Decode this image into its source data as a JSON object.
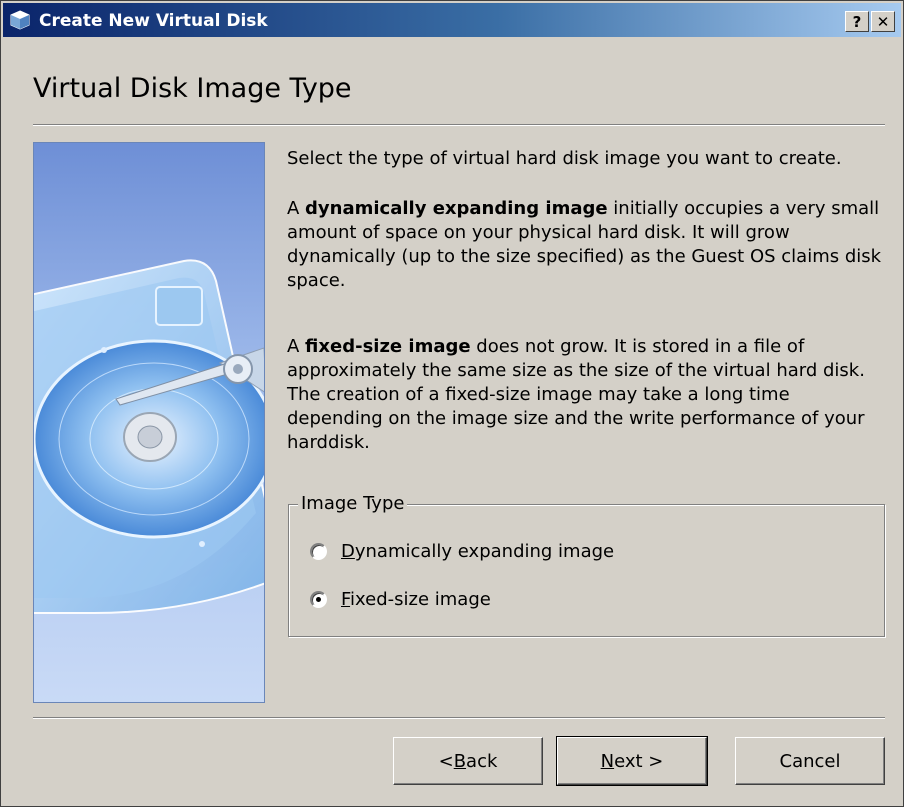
{
  "window": {
    "title": "Create New Virtual Disk",
    "help_glyph": "?",
    "close_glyph": "✕"
  },
  "page": {
    "heading": "Virtual Disk Image Type",
    "intro": "Select the type of virtual hard disk image you want to create.",
    "dynamic_prefix": "A ",
    "dynamic_term": "dynamically expanding image",
    "dynamic_rest": " initially occupies a very small amount of space on your physical hard disk. It will grow dynamically (up to the size specified) as the Guest OS claims disk space.",
    "fixed_prefix": "A ",
    "fixed_term": "fixed-size image",
    "fixed_rest": " does not grow. It is stored in a file of approximately the same size as the size of the virtual hard disk. The creation of a fixed-size image may take a long time depending on the image size and the write performance of your harddisk."
  },
  "image_type": {
    "legend": "Image Type",
    "options": [
      {
        "mnemonic": "D",
        "label_rest": "ynamically expanding image",
        "checked": false
      },
      {
        "mnemonic": "F",
        "label_rest": "ixed-size image",
        "checked": true
      }
    ]
  },
  "buttons": {
    "back_prefix": "< ",
    "back_mnemonic": "B",
    "back_rest": "ack",
    "next_mnemonic": "N",
    "next_rest": "ext >",
    "cancel": "Cancel"
  },
  "icons": {
    "app_icon": "virtualbox-cube-icon",
    "side_image": "hard-disk-illustration"
  },
  "colors": {
    "titlebar_start": "#0a246a",
    "titlebar_end": "#a6caf0",
    "dialog_bg": "#d4d0c8"
  }
}
